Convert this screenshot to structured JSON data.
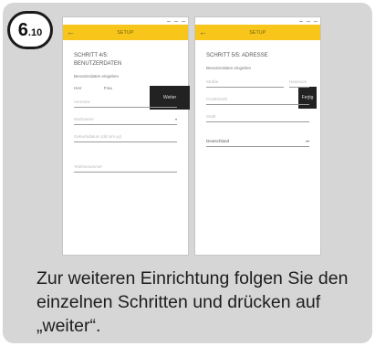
{
  "badge": {
    "number": "6",
    "sub": ".10"
  },
  "left_screen": {
    "app_title": "SETUP",
    "heading_line1": "SCHRITT 4/5:",
    "heading_line2": "BENUTZERDATEN",
    "subtitle": "Benutzerdaten eingeben",
    "radio_options": [
      "Herr",
      "Frau"
    ],
    "button": "Weiter",
    "fields": [
      "Vorname",
      "Nachname",
      "Geburtsdatum (dd.mm.yy)",
      "Telefonnummer"
    ]
  },
  "right_screen": {
    "app_title": "SETUP",
    "heading": "SCHRITT 5/5: ADRESSE",
    "subtitle": "Benutzerdaten eingeben",
    "button": "Fertig",
    "fields": {
      "street": "Straße",
      "house_number": "Hausnum",
      "postcode": "Postleitzahl",
      "city": "Stadt",
      "country": "Deutschland"
    }
  },
  "caption": "Zur weiteren Einrichtung folgen Sie den einzelnen Schritten und drücken auf „weiter“."
}
